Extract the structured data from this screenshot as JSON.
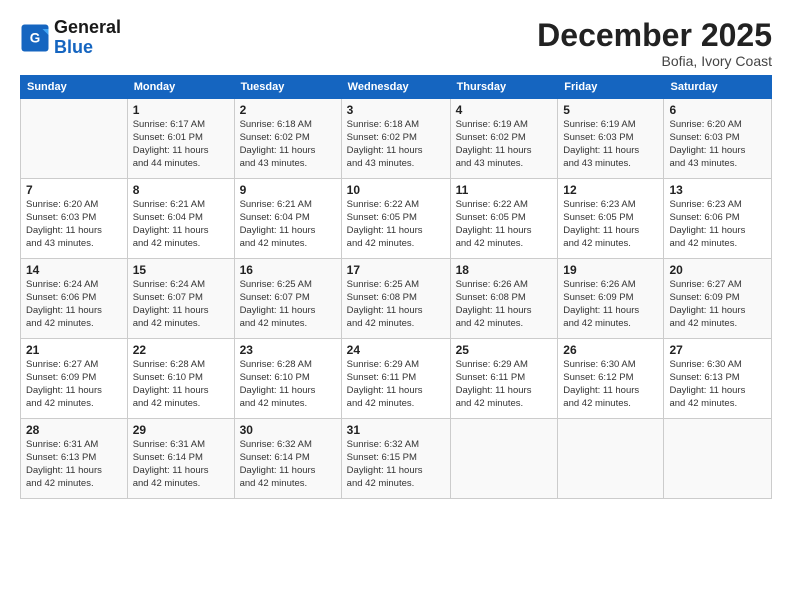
{
  "header": {
    "logo_line1": "General",
    "logo_line2": "Blue",
    "month_title": "December 2025",
    "location": "Bofia, Ivory Coast"
  },
  "days_of_week": [
    "Sunday",
    "Monday",
    "Tuesday",
    "Wednesday",
    "Thursday",
    "Friday",
    "Saturday"
  ],
  "weeks": [
    [
      {
        "day": "",
        "info": ""
      },
      {
        "day": "1",
        "info": "Sunrise: 6:17 AM\nSunset: 6:01 PM\nDaylight: 11 hours\nand 44 minutes."
      },
      {
        "day": "2",
        "info": "Sunrise: 6:18 AM\nSunset: 6:02 PM\nDaylight: 11 hours\nand 43 minutes."
      },
      {
        "day": "3",
        "info": "Sunrise: 6:18 AM\nSunset: 6:02 PM\nDaylight: 11 hours\nand 43 minutes."
      },
      {
        "day": "4",
        "info": "Sunrise: 6:19 AM\nSunset: 6:02 PM\nDaylight: 11 hours\nand 43 minutes."
      },
      {
        "day": "5",
        "info": "Sunrise: 6:19 AM\nSunset: 6:03 PM\nDaylight: 11 hours\nand 43 minutes."
      },
      {
        "day": "6",
        "info": "Sunrise: 6:20 AM\nSunset: 6:03 PM\nDaylight: 11 hours\nand 43 minutes."
      }
    ],
    [
      {
        "day": "7",
        "info": "Sunrise: 6:20 AM\nSunset: 6:03 PM\nDaylight: 11 hours\nand 43 minutes."
      },
      {
        "day": "8",
        "info": "Sunrise: 6:21 AM\nSunset: 6:04 PM\nDaylight: 11 hours\nand 42 minutes."
      },
      {
        "day": "9",
        "info": "Sunrise: 6:21 AM\nSunset: 6:04 PM\nDaylight: 11 hours\nand 42 minutes."
      },
      {
        "day": "10",
        "info": "Sunrise: 6:22 AM\nSunset: 6:05 PM\nDaylight: 11 hours\nand 42 minutes."
      },
      {
        "day": "11",
        "info": "Sunrise: 6:22 AM\nSunset: 6:05 PM\nDaylight: 11 hours\nand 42 minutes."
      },
      {
        "day": "12",
        "info": "Sunrise: 6:23 AM\nSunset: 6:05 PM\nDaylight: 11 hours\nand 42 minutes."
      },
      {
        "day": "13",
        "info": "Sunrise: 6:23 AM\nSunset: 6:06 PM\nDaylight: 11 hours\nand 42 minutes."
      }
    ],
    [
      {
        "day": "14",
        "info": "Sunrise: 6:24 AM\nSunset: 6:06 PM\nDaylight: 11 hours\nand 42 minutes."
      },
      {
        "day": "15",
        "info": "Sunrise: 6:24 AM\nSunset: 6:07 PM\nDaylight: 11 hours\nand 42 minutes."
      },
      {
        "day": "16",
        "info": "Sunrise: 6:25 AM\nSunset: 6:07 PM\nDaylight: 11 hours\nand 42 minutes."
      },
      {
        "day": "17",
        "info": "Sunrise: 6:25 AM\nSunset: 6:08 PM\nDaylight: 11 hours\nand 42 minutes."
      },
      {
        "day": "18",
        "info": "Sunrise: 6:26 AM\nSunset: 6:08 PM\nDaylight: 11 hours\nand 42 minutes."
      },
      {
        "day": "19",
        "info": "Sunrise: 6:26 AM\nSunset: 6:09 PM\nDaylight: 11 hours\nand 42 minutes."
      },
      {
        "day": "20",
        "info": "Sunrise: 6:27 AM\nSunset: 6:09 PM\nDaylight: 11 hours\nand 42 minutes."
      }
    ],
    [
      {
        "day": "21",
        "info": "Sunrise: 6:27 AM\nSunset: 6:09 PM\nDaylight: 11 hours\nand 42 minutes."
      },
      {
        "day": "22",
        "info": "Sunrise: 6:28 AM\nSunset: 6:10 PM\nDaylight: 11 hours\nand 42 minutes."
      },
      {
        "day": "23",
        "info": "Sunrise: 6:28 AM\nSunset: 6:10 PM\nDaylight: 11 hours\nand 42 minutes."
      },
      {
        "day": "24",
        "info": "Sunrise: 6:29 AM\nSunset: 6:11 PM\nDaylight: 11 hours\nand 42 minutes."
      },
      {
        "day": "25",
        "info": "Sunrise: 6:29 AM\nSunset: 6:11 PM\nDaylight: 11 hours\nand 42 minutes."
      },
      {
        "day": "26",
        "info": "Sunrise: 6:30 AM\nSunset: 6:12 PM\nDaylight: 11 hours\nand 42 minutes."
      },
      {
        "day": "27",
        "info": "Sunrise: 6:30 AM\nSunset: 6:13 PM\nDaylight: 11 hours\nand 42 minutes."
      }
    ],
    [
      {
        "day": "28",
        "info": "Sunrise: 6:31 AM\nSunset: 6:13 PM\nDaylight: 11 hours\nand 42 minutes."
      },
      {
        "day": "29",
        "info": "Sunrise: 6:31 AM\nSunset: 6:14 PM\nDaylight: 11 hours\nand 42 minutes."
      },
      {
        "day": "30",
        "info": "Sunrise: 6:32 AM\nSunset: 6:14 PM\nDaylight: 11 hours\nand 42 minutes."
      },
      {
        "day": "31",
        "info": "Sunrise: 6:32 AM\nSunset: 6:15 PM\nDaylight: 11 hours\nand 42 minutes."
      },
      {
        "day": "",
        "info": ""
      },
      {
        "day": "",
        "info": ""
      },
      {
        "day": "",
        "info": ""
      }
    ]
  ]
}
